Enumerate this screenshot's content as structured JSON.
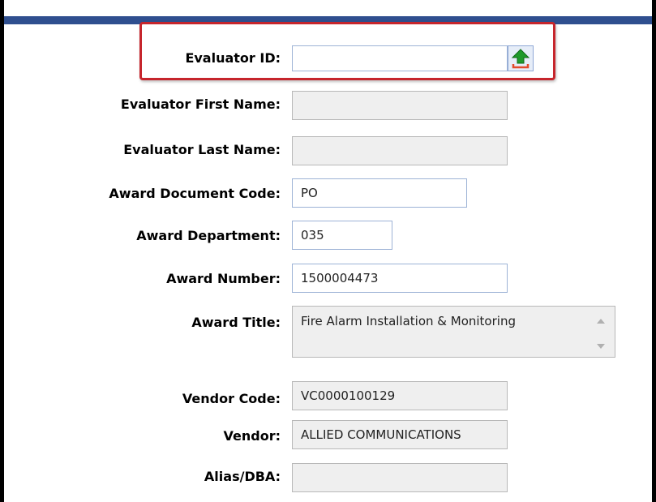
{
  "form": {
    "evaluator_id": {
      "label": "Evaluator ID:",
      "value": ""
    },
    "evaluator_first_name": {
      "label": "Evaluator First Name:",
      "value": ""
    },
    "evaluator_last_name": {
      "label": "Evaluator Last Name:",
      "value": ""
    },
    "award_document_code": {
      "label": "Award Document Code:",
      "value": "PO"
    },
    "award_department": {
      "label": "Award Department:",
      "value": "035"
    },
    "award_number": {
      "label": "Award Number:",
      "value": "1500004473"
    },
    "award_title": {
      "label": "Award Title:",
      "value": "Fire Alarm Installation & Monitoring"
    },
    "vendor_code": {
      "label": "Vendor Code:",
      "value": "VC0000100129"
    },
    "vendor": {
      "label": "Vendor:",
      "value": "ALLIED COMMUNICATIONS"
    },
    "alias_dba": {
      "label": "Alias/DBA:",
      "value": ""
    }
  },
  "icons": {
    "lookup": "upload-arrow-icon"
  },
  "colors": {
    "highlight_border": "#c6252c",
    "header_stripe": "#2f4f8f",
    "readonly_field": "#efefef",
    "lookup_arrow": "#1f9a2a"
  }
}
